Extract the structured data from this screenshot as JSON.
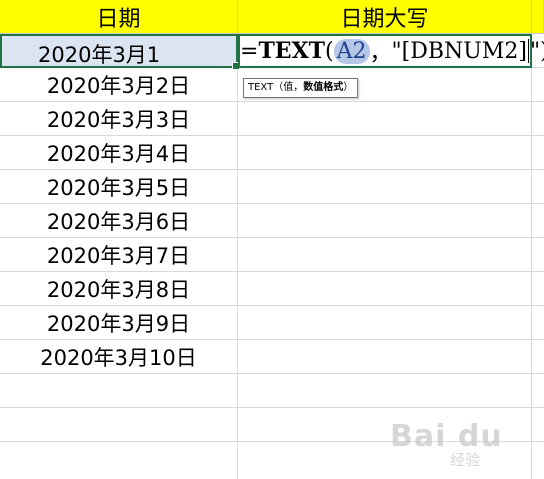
{
  "headers": {
    "col_a": "日期",
    "col_b": "日期大写"
  },
  "active_cell": {
    "value": "2020年3月1"
  },
  "formula": {
    "prefix": "=",
    "fn": "TEXT",
    "open_paren": "(",
    "ref": "A2",
    "sep": "，",
    "arg": "\"[DBNUM2]",
    "quote_close": "\"",
    "close_paren": ")"
  },
  "tooltip": {
    "fn": "TEXT",
    "open": "（",
    "arg1": "值",
    "sep": "，",
    "arg2": "数值格式",
    "close": "）"
  },
  "dates": [
    "2020年3月2日",
    "2020年3月3日",
    "2020年3月4日",
    "2020年3月5日",
    "2020年3月6日",
    "2020年3月7日",
    "2020年3月8日",
    "2020年3月9日",
    "2020年3月10日"
  ],
  "watermark": {
    "logo": "Bai du",
    "sub": "经验"
  },
  "colors": {
    "header_bg": "#ffff00",
    "selection_border": "#217346",
    "selection_fill": "#dbe5f1",
    "ref_highlight": "#b4c7e7",
    "gridline": "#d9d9d9"
  }
}
